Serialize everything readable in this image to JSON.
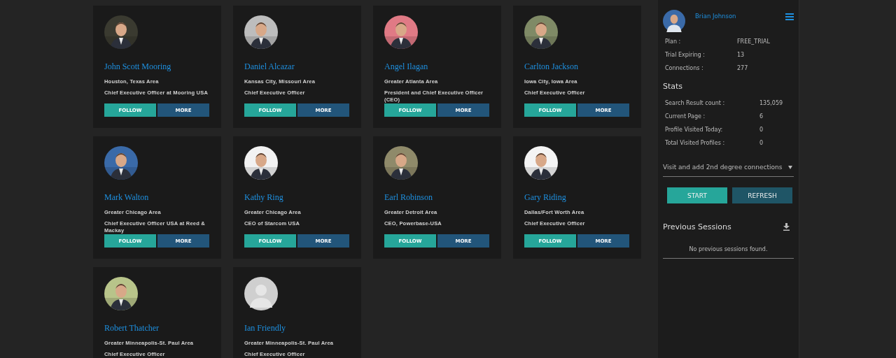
{
  "profiles": [
    {
      "name": "John Scott Mooring",
      "location": "Houston, Texas Area",
      "headline": "Chief Executive Officer at Mooring USA",
      "follow": "FOLLOW",
      "more": "MORE"
    },
    {
      "name": "Daniel Alcazar",
      "location": "Kansas City, Missouri Area",
      "headline": "Chief Executive Officer",
      "follow": "FOLLOW",
      "more": "MORE"
    },
    {
      "name": "Angel Ilagan",
      "location": "Greater Atlanta Area",
      "headline": "President and Chief Executive Officer (CEO)",
      "follow": "FOLLOW",
      "more": "MORE"
    },
    {
      "name": "Carlton Jackson",
      "location": "Iowa City, Iowa Area",
      "headline": "Chief Executive Officer",
      "follow": "FOLLOW",
      "more": "MORE"
    },
    {
      "name": "Mark Walton",
      "location": "Greater Chicago Area",
      "headline": "Chief Executive Officer USA at Reed & Mackay",
      "follow": "FOLLOW",
      "more": "MORE"
    },
    {
      "name": "Kathy Ring",
      "location": "Greater Chicago Area",
      "headline": "CEO of Starcom USA",
      "follow": "FOLLOW",
      "more": "MORE"
    },
    {
      "name": "Earl Robinson",
      "location": "Greater Detroit Area",
      "headline": "CEO, Powerbase-USA",
      "follow": "FOLLOW",
      "more": "MORE"
    },
    {
      "name": "Gary Riding",
      "location": "Dallas/Fort Worth Area",
      "headline": "Chief Executive Officer",
      "follow": "FOLLOW",
      "more": "MORE"
    },
    {
      "name": "Robert Thatcher",
      "location": "Greater Minneapolis-St. Paul Area",
      "headline": "Chief Executive Officer"
    },
    {
      "name": "Ian Friendly",
      "location": "Greater Minneapolis-St. Paul Area",
      "headline": "Chief Executive Officer",
      "avatar": {
        "kind": "placeholder"
      }
    }
  ],
  "sidebar": {
    "user": {
      "name": "Brian Johnson"
    },
    "account": [
      {
        "label": "Plan :",
        "value": "FREE_TRIAL"
      },
      {
        "label": "Trial Expiring :",
        "value": "13"
      },
      {
        "label": "Connections :",
        "value": "277"
      }
    ],
    "stats_title": "Stats",
    "stats": [
      {
        "label": "Search Result count :",
        "value": "135,059"
      },
      {
        "label": "Current Page :",
        "value": "6"
      },
      {
        "label": "Profile Visited Today:",
        "value": "0"
      },
      {
        "label": "Total Visited Profiles :",
        "value": "0"
      }
    ],
    "action_select": {
      "value": "Visit and add 2nd degree connections"
    },
    "buttons": [
      {
        "label": "START",
        "kind": "primary"
      },
      {
        "label": "REFRESH",
        "kind": "secondary"
      }
    ],
    "sessions": {
      "title": "Previous Sessions",
      "empty": "No previous sessions found."
    }
  }
}
